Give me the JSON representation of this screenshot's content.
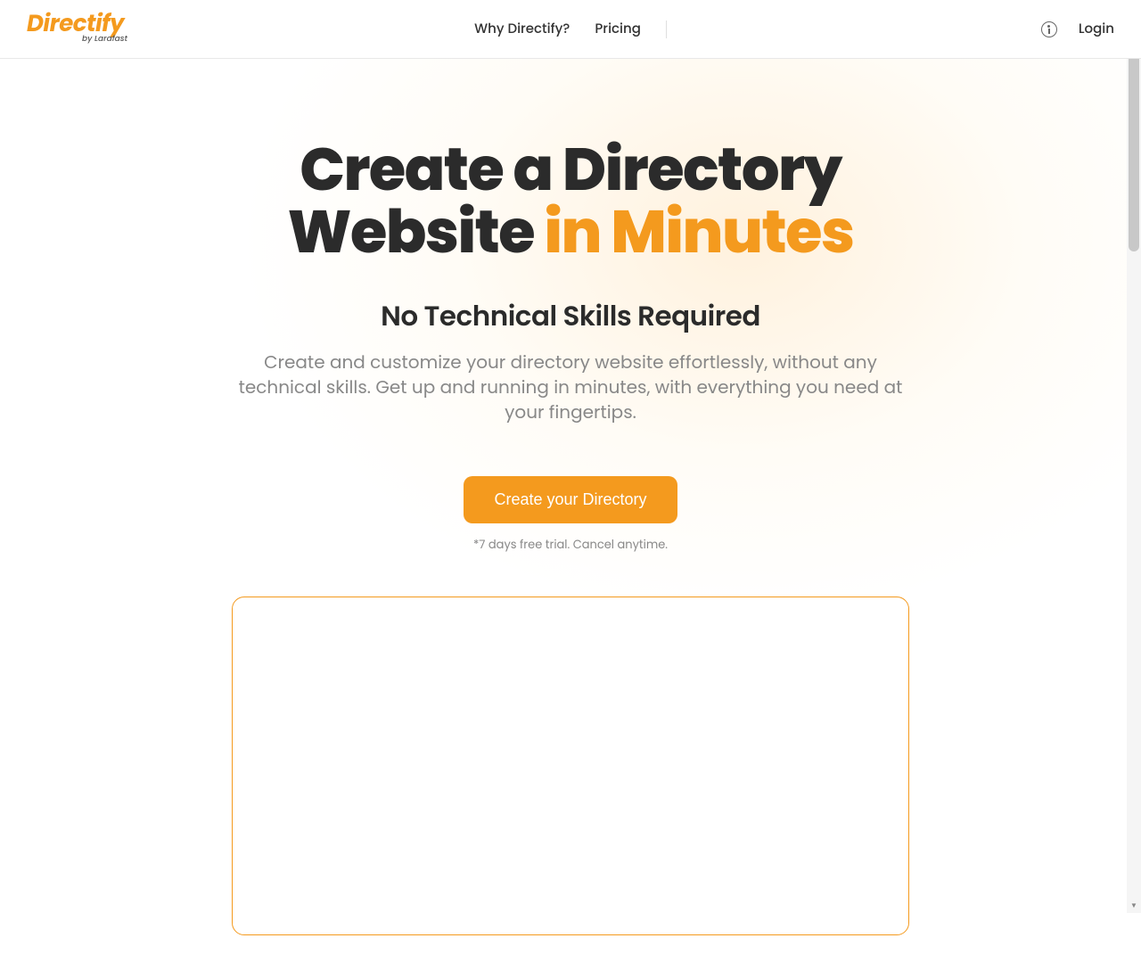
{
  "header": {
    "logo_main": "Directify",
    "logo_sub": "by Larafast",
    "nav": {
      "why": "Why Directify?",
      "pricing": "Pricing"
    },
    "login": "Login"
  },
  "hero": {
    "title_line1": "Create a Directory",
    "title_line2_a": "Website ",
    "title_line2_b": "in Minutes",
    "subtitle": "No Technical Skills Required",
    "description": "Create and customize your directory website effortlessly, without any technical skills. Get up and running in minutes, with everything you need at your fingertips.",
    "cta_label": "Create your Directory",
    "cta_note": "*7 days free trial. Cancel anytime."
  }
}
